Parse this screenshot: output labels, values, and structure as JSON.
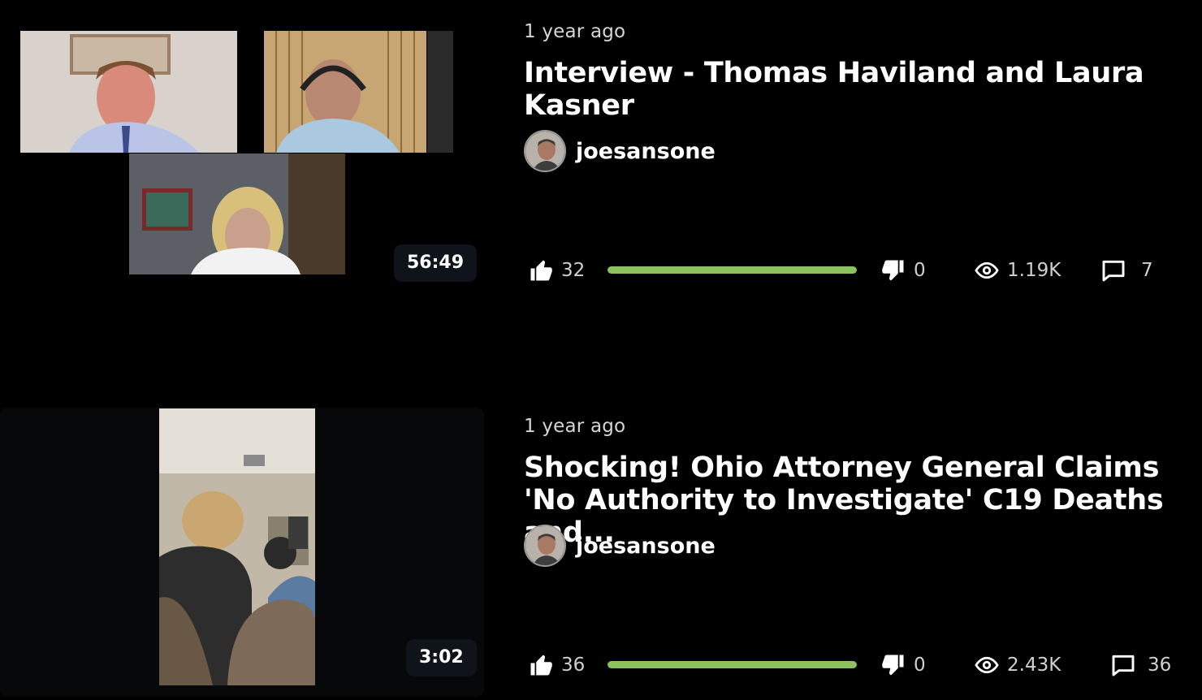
{
  "videos": [
    {
      "age": "1 year ago",
      "title": "Interview - Thomas Haviland and Laura Kasner",
      "channel": "joesansone",
      "duration": "56:49",
      "likes": "32",
      "dislikes": "0",
      "like_ratio": 1.0,
      "views": "1.19K",
      "comments": "7"
    },
    {
      "age": "1 year ago",
      "title": "Shocking! Ohio Attorney General Claims 'No Authority to Investigate' C19 Deaths and...",
      "channel": "joesansone",
      "duration": "3:02",
      "likes": "36",
      "dislikes": "0",
      "like_ratio": 1.0,
      "views": "2.43K",
      "comments": "36"
    }
  ],
  "colors": {
    "background": "#000000",
    "ratio_fill": "#8dc160",
    "badge": "#0f141a"
  },
  "icons": {
    "like": "thumbs-up-icon",
    "dislike": "thumbs-down-icon",
    "views": "eye-icon",
    "comments": "comment-icon"
  }
}
